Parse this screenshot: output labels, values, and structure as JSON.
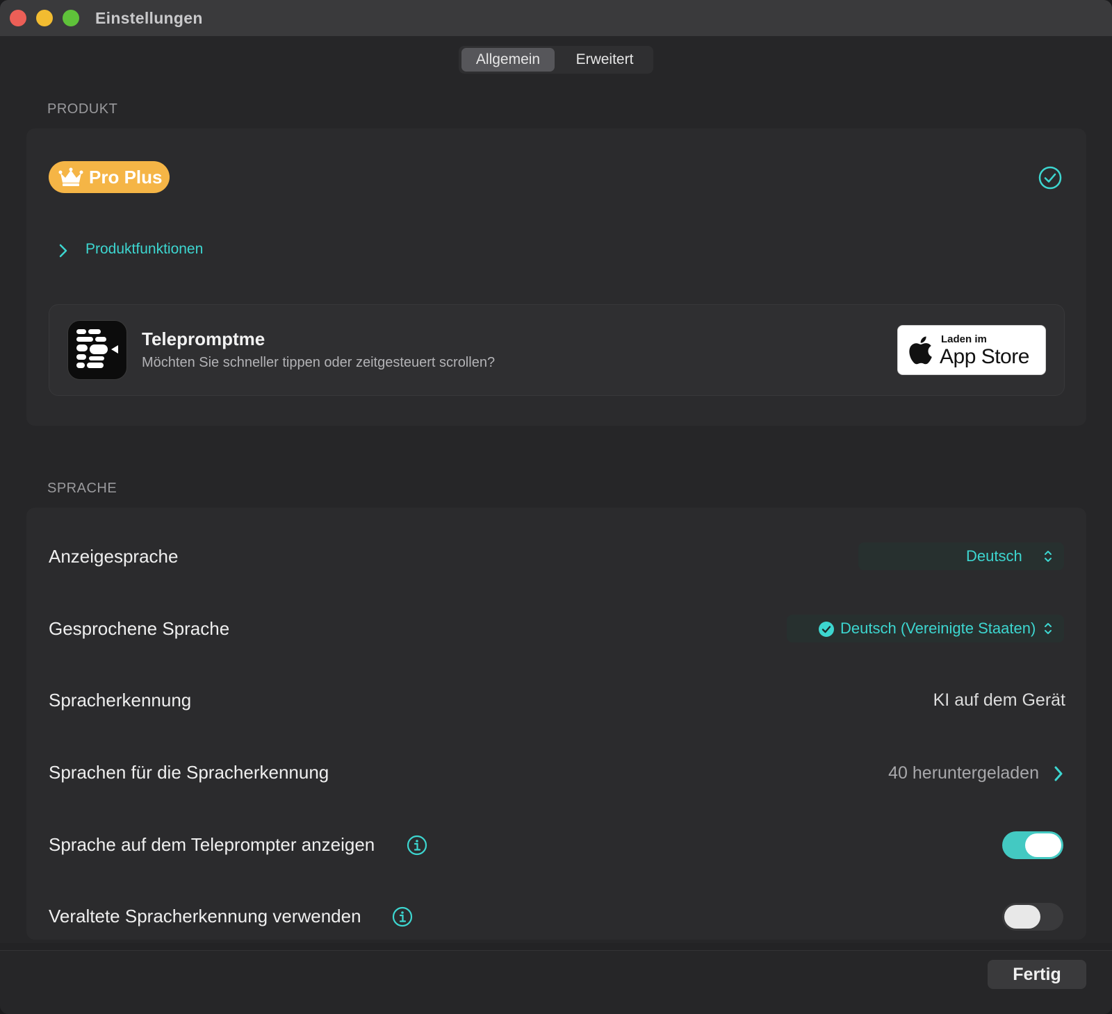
{
  "window": {
    "title": "Einstellungen"
  },
  "tabs": [
    {
      "label": "Allgemein",
      "selected": true
    },
    {
      "label": "Erweitert",
      "selected": false
    }
  ],
  "product": {
    "section_header": "PRODUKT",
    "badge_label": "Pro Plus",
    "badge_icon": "crown-icon",
    "status_icon": "check-circle-icon",
    "features_link": "Produktfunktionen",
    "promo": {
      "app_name": "Telepromptme",
      "description": "Möchten Sie schneller tippen oder zeitgesteuert scrollen?",
      "store_small": "Laden im",
      "store_big": "App Store"
    }
  },
  "language": {
    "section_header": "SPRACHE",
    "display_language": {
      "label": "Anzeigesprache",
      "value": "Deutsch"
    },
    "spoken_language": {
      "label": "Gesprochene Sprache",
      "value": "Deutsch (Vereinigte Staaten)"
    },
    "recognition": {
      "label": "Spracherkennung",
      "value": "KI auf dem Gerät"
    },
    "recognition_languages": {
      "label": "Sprachen für die Spracherkennung",
      "value": "40 heruntergeladen"
    },
    "show_language": {
      "label": "Sprache auf dem Teleprompter anzeigen",
      "enabled": true
    },
    "legacy_recognition": {
      "label": "Veraltete Spracherkennung verwenden",
      "enabled": false
    }
  },
  "footer": {
    "done_label": "Fertig"
  },
  "colors": {
    "accent": "#3dd6d0",
    "badge": "#f5b546",
    "toggle_on": "#43c9c2"
  }
}
